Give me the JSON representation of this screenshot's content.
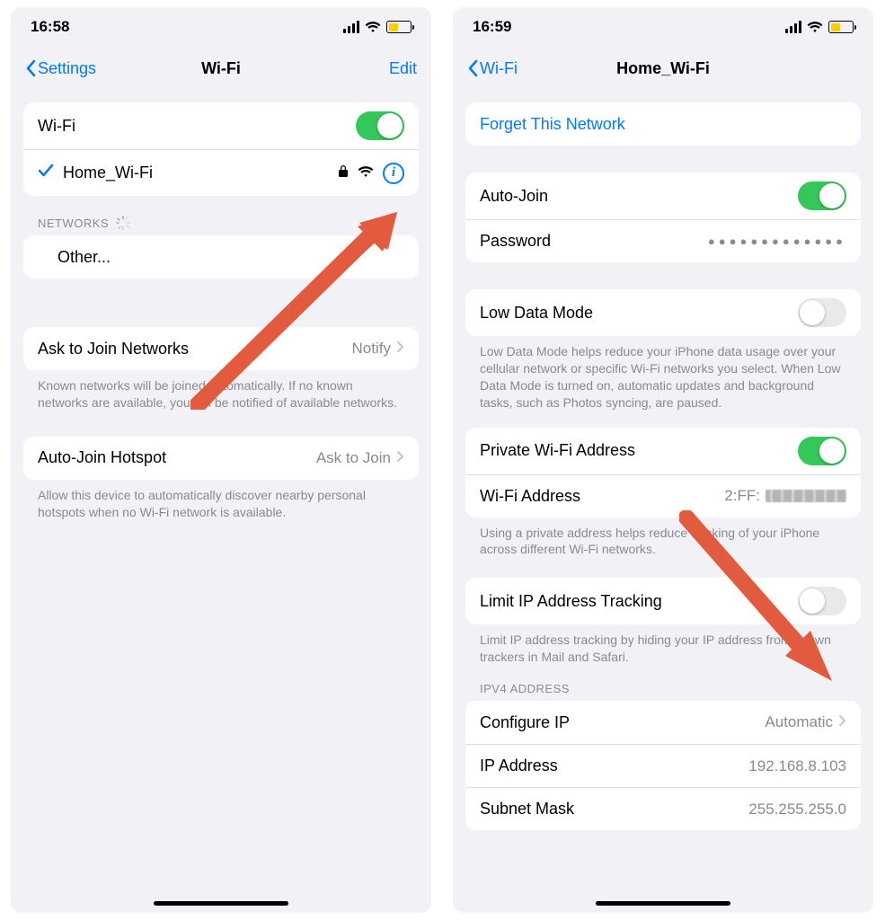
{
  "left": {
    "status_time": "16:58",
    "nav": {
      "back": "Settings",
      "title": "Wi-Fi",
      "edit": "Edit"
    },
    "wifi_row": {
      "label": "Wi-Fi",
      "on": true
    },
    "connected": {
      "name": "Home_Wi-Fi"
    },
    "networks_header": "NETWORKS",
    "other": "Other...",
    "ask_join": {
      "label": "Ask to Join Networks",
      "value": "Notify"
    },
    "ask_join_footer": "Known networks will be joined automatically. If no known networks are available, you will be notified of available networks.",
    "auto_hotspot": {
      "label": "Auto-Join Hotspot",
      "value": "Ask to Join"
    },
    "auto_hotspot_footer": "Allow this device to automatically discover nearby personal hotspots when no Wi-Fi network is available."
  },
  "right": {
    "status_time": "16:59",
    "nav": {
      "back": "Wi-Fi",
      "title": "Home_Wi-Fi"
    },
    "forget": "Forget This Network",
    "auto_join": {
      "label": "Auto-Join",
      "on": true
    },
    "password": {
      "label": "Password",
      "masked": "●●●●●●●●●●●●●"
    },
    "low_data": {
      "label": "Low Data Mode",
      "on": false
    },
    "low_data_footer": "Low Data Mode helps reduce your iPhone data usage over your cellular network or specific Wi-Fi networks you select. When Low Data Mode is turned on, automatic updates and background tasks, such as Photos syncing, are paused.",
    "private_addr": {
      "label": "Private Wi-Fi Address",
      "on": true
    },
    "wifi_addr": {
      "label": "Wi-Fi Address",
      "prefix": "2:FF:"
    },
    "private_footer": "Using a private address helps reduce tracking of your iPhone across different Wi-Fi networks.",
    "limit_ip": {
      "label": "Limit IP Address Tracking",
      "on": false
    },
    "limit_ip_footer": "Limit IP address tracking by hiding your IP address from known trackers in Mail and Safari.",
    "ipv4_header": "IPV4 ADDRESS",
    "configure_ip": {
      "label": "Configure IP",
      "value": "Automatic"
    },
    "ip_address": {
      "label": "IP Address",
      "value": "192.168.8.103"
    },
    "subnet": {
      "label": "Subnet Mask",
      "value": "255.255.255.0"
    }
  }
}
